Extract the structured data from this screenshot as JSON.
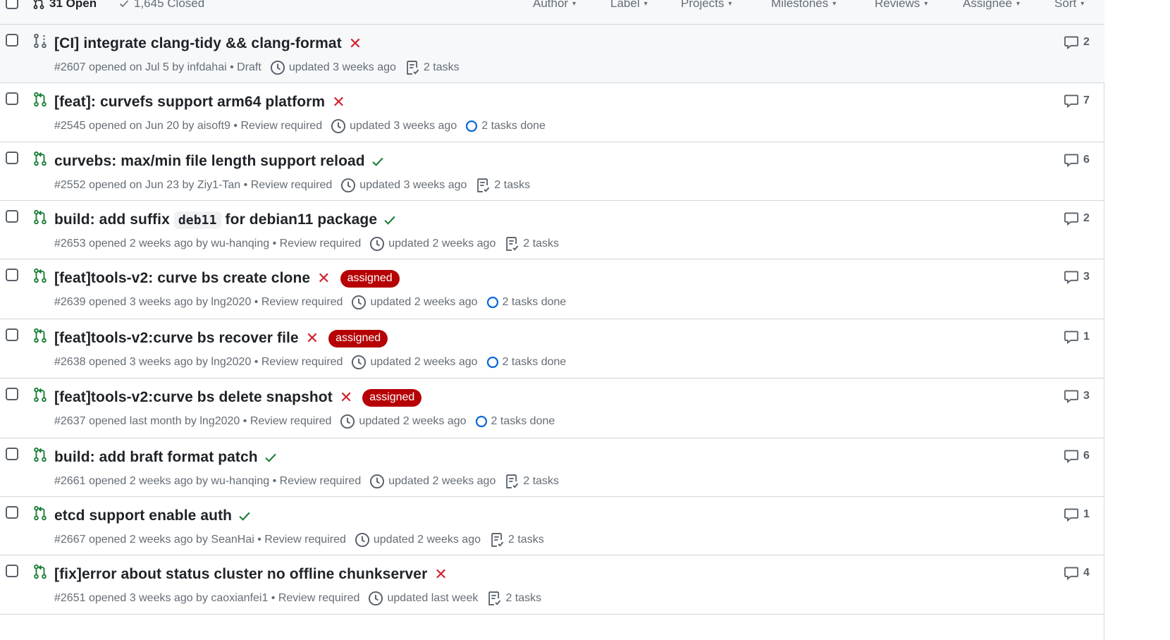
{
  "header": {
    "open_label": "31 Open",
    "closed_label": "1,645 Closed",
    "filters": [
      "Author",
      "Label",
      "Projects",
      "Milestones",
      "Reviews",
      "Assignee",
      "Sort"
    ]
  },
  "colors": {
    "open_green": "#1a7f37",
    "draft_gray": "#57606a",
    "fail_red": "#cf222e",
    "label_red": "#b60205",
    "progress_blue": "#0969da"
  },
  "rows": [
    {
      "title": "[CI] integrate clang-tidy && clang-format",
      "status": "fail",
      "label": "",
      "meta": "#2607 opened on Jul 5 by infdahai • Draft",
      "updated": "updated 3 weeks ago",
      "tasks": "2 tasks",
      "tasks_icon": "tasklist-icon",
      "comments": "2",
      "draft": true
    },
    {
      "title": "[feat]: curvefs support arm64 platform",
      "status": "fail",
      "label": "",
      "meta": "#2545 opened on Jun 20 by aisoft9 • Review required",
      "updated": "updated 3 weeks ago",
      "tasks": "2 tasks done",
      "tasks_icon": "progress-circle-icon",
      "comments": "7"
    },
    {
      "title": "curvebs: max/min file length support reload",
      "status": "pass",
      "label": "",
      "meta": "#2552 opened on Jun 23 by Ziy1-Tan • Review required",
      "updated": "updated 3 weeks ago",
      "tasks": "2 tasks",
      "tasks_icon": "tasklist-icon",
      "comments": "6"
    },
    {
      "title_pre": "build: add suffix",
      "title_code": "deb11",
      "title_post": "for debian11 package",
      "status": "pass",
      "label": "",
      "meta": "#2653 opened 2 weeks ago by wu-hanqing • Review required",
      "updated": "updated 2 weeks ago",
      "tasks": "2 tasks",
      "tasks_icon": "tasklist-icon",
      "comments": "2"
    },
    {
      "title": "[feat]tools-v2: curve bs create clone",
      "status": "fail",
      "label": "assigned",
      "meta": "#2639 opened 3 weeks ago by lng2020 • Review required",
      "updated": "updated 2 weeks ago",
      "tasks": "2 tasks done",
      "tasks_icon": "progress-circle-icon",
      "comments": "3"
    },
    {
      "title": "[feat]tools-v2:curve bs recover file",
      "status": "fail",
      "label": "assigned",
      "meta": "#2638 opened 3 weeks ago by lng2020 • Review required",
      "updated": "updated 2 weeks ago",
      "tasks": "2 tasks done",
      "tasks_icon": "progress-circle-icon",
      "comments": "1"
    },
    {
      "title": "[feat]tools-v2:curve bs delete snapshot",
      "status": "fail",
      "label": "assigned",
      "meta": "#2637 opened last month by lng2020 • Review required",
      "updated": "updated 2 weeks ago",
      "tasks": "2 tasks done",
      "tasks_icon": "progress-circle-icon",
      "comments": "3"
    },
    {
      "title": "build: add braft format patch",
      "status": "pass",
      "label": "",
      "meta": "#2661 opened 2 weeks ago by wu-hanqing • Review required",
      "updated": "updated 2 weeks ago",
      "tasks": "2 tasks",
      "tasks_icon": "tasklist-icon",
      "comments": "6"
    },
    {
      "title": "etcd support enable auth",
      "status": "pass",
      "label": "",
      "meta": "#2667 opened 2 weeks ago by SeanHai • Review required",
      "updated": "updated 2 weeks ago",
      "tasks": "2 tasks",
      "tasks_icon": "tasklist-icon",
      "comments": "1"
    },
    {
      "title": "[fix]error about status cluster no offline chunkserver",
      "status": "fail",
      "label": "",
      "meta": "#2651 opened 3 weeks ago by caoxianfei1 • Review required",
      "updated": "updated last week",
      "tasks": "2 tasks",
      "tasks_icon": "tasklist-icon",
      "comments": "4"
    }
  ]
}
